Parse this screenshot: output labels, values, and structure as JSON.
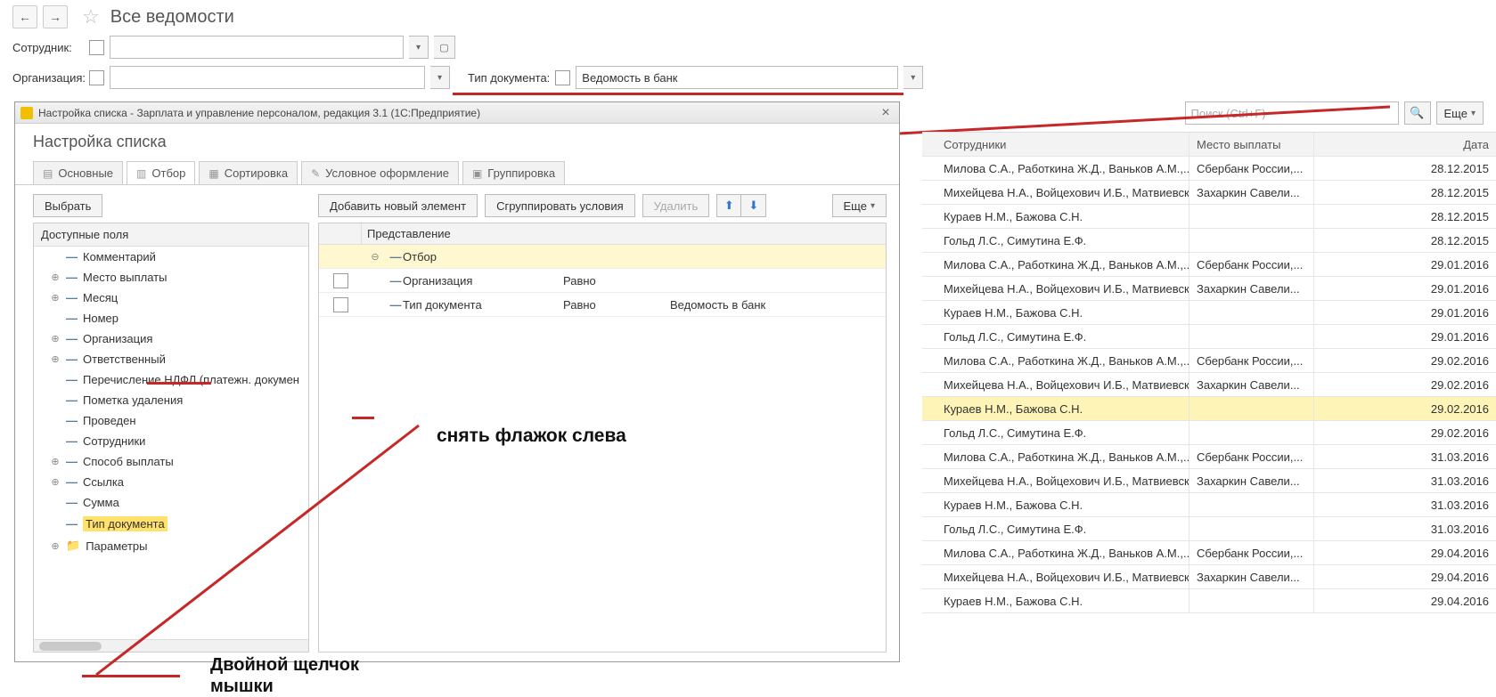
{
  "header": {
    "page_title": "Все ведомости"
  },
  "filters": {
    "employee_label": "Сотрудник:",
    "org_label": "Организация:",
    "doc_type_label": "Тип документа:",
    "doc_type_value": "Ведомость в банк"
  },
  "right_toolbar": {
    "search_placeholder": "Поиск (Ctrl+F)",
    "more_label": "Еще"
  },
  "table": {
    "columns": {
      "c1": "Сотрудники",
      "c2": "Место выплаты",
      "c3": "Дата"
    },
    "rows": [
      {
        "c1": "Милова С.А., Работкина Ж.Д., Ваньков А.М.,...",
        "c2": "Сбербанк России,...",
        "c3": "28.12.2015",
        "sel": false
      },
      {
        "c1": "Михейцева Н.А., Войцехович И.Б., Матвиевск...",
        "c2": "Захаркин Савели...",
        "c3": "28.12.2015",
        "sel": false
      },
      {
        "c1": "Кураев Н.М., Бажова С.Н.",
        "c2": "",
        "c3": "28.12.2015",
        "sel": false
      },
      {
        "c1": "Гольд Л.С., Симутина Е.Ф.",
        "c2": "",
        "c3": "28.12.2015",
        "sel": false
      },
      {
        "c1": "Милова С.А., Работкина Ж.Д., Ваньков А.М.,...",
        "c2": "Сбербанк России,...",
        "c3": "29.01.2016",
        "sel": false
      },
      {
        "c1": "Михейцева Н.А., Войцехович И.Б., Матвиевск...",
        "c2": "Захаркин Савели...",
        "c3": "29.01.2016",
        "sel": false
      },
      {
        "c1": "Кураев Н.М., Бажова С.Н.",
        "c2": "",
        "c3": "29.01.2016",
        "sel": false
      },
      {
        "c1": "Гольд Л.С., Симутина Е.Ф.",
        "c2": "",
        "c3": "29.01.2016",
        "sel": false
      },
      {
        "c1": "Милова С.А., Работкина Ж.Д., Ваньков А.М.,...",
        "c2": "Сбербанк России,...",
        "c3": "29.02.2016",
        "sel": false
      },
      {
        "c1": "Михейцева Н.А., Войцехович И.Б., Матвиевск...",
        "c2": "Захаркин Савели...",
        "c3": "29.02.2016",
        "sel": false
      },
      {
        "c1": "Кураев Н.М., Бажова С.Н.",
        "c2": "",
        "c3": "29.02.2016",
        "sel": true
      },
      {
        "c1": "Гольд Л.С., Симутина Е.Ф.",
        "c2": "",
        "c3": "29.02.2016",
        "sel": false
      },
      {
        "c1": "Милова С.А., Работкина Ж.Д., Ваньков А.М.,...",
        "c2": "Сбербанк России,...",
        "c3": "31.03.2016",
        "sel": false
      },
      {
        "c1": "Михейцева Н.А., Войцехович И.Б., Матвиевск...",
        "c2": "Захаркин Савели...",
        "c3": "31.03.2016",
        "sel": false
      },
      {
        "c1": "Кураев Н.М., Бажова С.Н.",
        "c2": "",
        "c3": "31.03.2016",
        "sel": false
      },
      {
        "c1": "Гольд Л.С., Симутина Е.Ф.",
        "c2": "",
        "c3": "31.03.2016",
        "sel": false
      },
      {
        "c1": "Милова С.А., Работкина Ж.Д., Ваньков А.М.,...",
        "c2": "Сбербанк России,...",
        "c3": "29.04.2016",
        "sel": false
      },
      {
        "c1": "Михейцева Н.А., Войцехович И.Б., Матвиевск...",
        "c2": "Захаркин Савели...",
        "c3": "29.04.2016",
        "sel": false
      },
      {
        "c1": "Кураев Н.М., Бажова С.Н.",
        "c2": "",
        "c3": "29.04.2016",
        "sel": false
      }
    ]
  },
  "modal": {
    "window_title": "Настройка списка - Зарплата и управление персоналом, редакция 3.1 (1С:Предприятие)",
    "heading": "Настройка списка",
    "tabs": {
      "main": "Основные",
      "filter": "Отбор",
      "sort": "Сортировка",
      "format": "Условное оформление",
      "group": "Группировка"
    },
    "left": {
      "choose": "Выбрать",
      "fields_header": "Доступные поля",
      "items": [
        {
          "exp": "",
          "label": "Комментарий"
        },
        {
          "exp": "+",
          "label": "Место выплаты"
        },
        {
          "exp": "+",
          "label": "Месяц"
        },
        {
          "exp": "",
          "label": "Номер"
        },
        {
          "exp": "+",
          "label": "Организация"
        },
        {
          "exp": "+",
          "label": "Ответственный"
        },
        {
          "exp": "",
          "label": "Перечисление НДФЛ (платежн. докумен"
        },
        {
          "exp": "",
          "label": "Пометка удаления"
        },
        {
          "exp": "",
          "label": "Проведен"
        },
        {
          "exp": "",
          "label": "Сотрудники"
        },
        {
          "exp": "+",
          "label": "Способ выплаты"
        },
        {
          "exp": "+",
          "label": "Ссылка"
        },
        {
          "exp": "",
          "label": "Сумма"
        },
        {
          "exp": "",
          "label": "Тип документа",
          "selected": true
        },
        {
          "exp": "+",
          "label": "Параметры",
          "folder": true
        }
      ]
    },
    "right": {
      "add": "Добавить новый элемент",
      "group_btn": "Сгруппировать условия",
      "delete": "Удалить",
      "more": "Еще",
      "header_pres": "Представление",
      "filter_root": "Отбор",
      "rows": [
        {
          "name": "Организация",
          "op": "Равно",
          "val": ""
        },
        {
          "name": "Тип документа",
          "op": "Равно",
          "val": "Ведомость в банк"
        }
      ]
    }
  },
  "annotations": {
    "uncheck": "снять флажок слева",
    "dblclick1": "Двойной щелчок",
    "dblclick2": "мышки"
  }
}
